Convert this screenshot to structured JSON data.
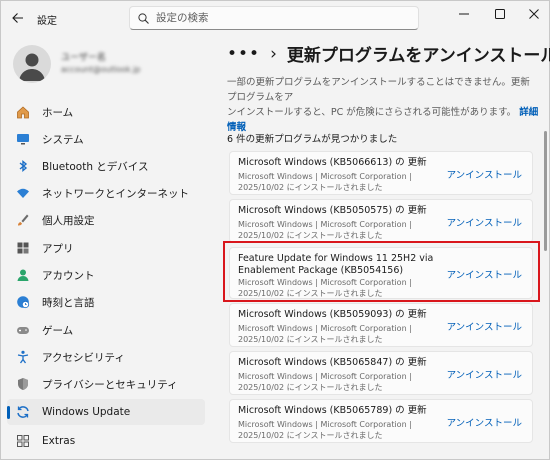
{
  "app": {
    "title": "設定",
    "back_icon": "arrow-left-icon"
  },
  "search": {
    "placeholder": "設定の検索",
    "value": ""
  },
  "window_controls": [
    "minimize-icon",
    "maximize-icon",
    "close-icon"
  ],
  "user": {
    "name": "ユーザー名",
    "email": "account@outlook.jp"
  },
  "sidebar": {
    "items": [
      {
        "label": "ホーム",
        "icon": "home-icon",
        "color": "#d88a39"
      },
      {
        "label": "システム",
        "icon": "monitor-icon",
        "color": "#1c6fc7"
      },
      {
        "label": "Bluetooth とデバイス",
        "icon": "bluetooth-icon",
        "color": "#1c6fc7"
      },
      {
        "label": "ネットワークとインターネット",
        "icon": "wifi-icon",
        "color": "#1c6fc7"
      },
      {
        "label": "個人用設定",
        "icon": "brush-icon",
        "color": "#c8733a"
      },
      {
        "label": "アプリ",
        "icon": "apps-icon",
        "color": "#555555"
      },
      {
        "label": "アカウント",
        "icon": "person-icon",
        "color": "#2aa56b"
      },
      {
        "label": "時刻と言語",
        "icon": "globe-clock-icon",
        "color": "#1c6fc7"
      },
      {
        "label": "ゲーム",
        "icon": "gamepad-icon",
        "color": "#777777"
      },
      {
        "label": "アクセシビリティ",
        "icon": "accessibility-icon",
        "color": "#1c6fc7"
      },
      {
        "label": "プライバシーとセキュリティ",
        "icon": "shield-icon",
        "color": "#6b6b6b"
      },
      {
        "label": "Windows Update",
        "icon": "sync-icon",
        "color": "#1c6fc7",
        "active": true
      },
      {
        "label": "Extras",
        "icon": "grid-icon",
        "color": "#555555"
      }
    ]
  },
  "main": {
    "breadcrumb_more": "•••",
    "breadcrumb_sep": "›",
    "title": "更新プログラムをアンインストールす",
    "description_line1": "一部の更新プログラムをアンインストールすることはできません。更新プログラムをア",
    "description_line2": "ンインストールすると、PC が危険にさらされる可能性があります。",
    "details_link": "詳細情報",
    "count_text": "6 件の更新プログラムが見つかりました",
    "uninstall_label": "アンインストール",
    "updates": [
      {
        "name": "Microsoft Windows (KB5066613) の 更新",
        "meta1": "Microsoft Windows  |  Microsoft Corporation  |",
        "meta2": "2025/10/02 にインストールされました"
      },
      {
        "name": "Microsoft Windows (KB5050575) の 更新",
        "meta1": "Microsoft Windows  |  Microsoft Corporation  |",
        "meta2": "2025/10/02 にインストールされました"
      },
      {
        "name": "Feature Update for Windows 11 25H2 via",
        "name2": "Enablement Package (KB5054156)",
        "meta1": "Microsoft Windows  |  Microsoft Corporation  |",
        "meta2": "2025/10/02 にインストールされました",
        "highlighted": true
      },
      {
        "name": "Microsoft Windows (KB5059093) の 更新",
        "meta1": "Microsoft Windows  |  Microsoft Corporation  |",
        "meta2": "2025/10/02 にインストールされました"
      },
      {
        "name": "Microsoft Windows (KB5065847) の 更新",
        "meta1": "Microsoft Windows  |  Microsoft Corporation  |",
        "meta2": "2025/10/02 にインストールされました"
      },
      {
        "name": "Microsoft Windows (KB5065789) の 更新",
        "meta1": "Microsoft Windows  |  Microsoft Corporation  |",
        "meta2": "2025/10/02 にインストールされました"
      }
    ]
  },
  "colors": {
    "accent": "#005fb8",
    "highlight_box": "#d9161c"
  }
}
